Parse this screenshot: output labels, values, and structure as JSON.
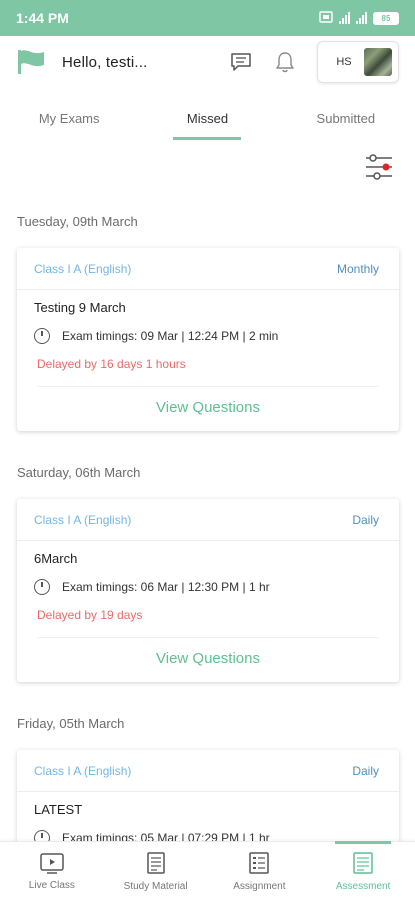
{
  "status_bar": {
    "time": "1:44 PM",
    "battery": "85"
  },
  "header": {
    "greeting": "Hello, testi...",
    "profile_initials": "HS"
  },
  "tabs": [
    {
      "label": "My Exams",
      "active": false
    },
    {
      "label": "Missed",
      "active": true
    },
    {
      "label": "Submitted",
      "active": false
    }
  ],
  "exams": [
    {
      "date": "Tuesday, 09th March",
      "class": "Class I A (English)",
      "frequency": "Monthly",
      "title": "Testing 9 March",
      "timings": "Exam timings:  09 Mar | 12:24 PM | 2 min",
      "delay": "Delayed by 16 days 1 hours",
      "action": "View Questions"
    },
    {
      "date": "Saturday, 06th March",
      "class": "Class I A (English)",
      "frequency": "Daily",
      "title": "6March",
      "timings": "Exam timings:  06 Mar | 12:30 PM | 1 hr",
      "delay": "Delayed by 19 days",
      "action": "View Questions"
    },
    {
      "date": "Friday, 05th March",
      "class": "Class I A (English)",
      "frequency": "Daily",
      "title": "LATEST",
      "timings": "Exam timings:  05 Mar | 07:29 PM | 1 hr",
      "delay": "",
      "action": ""
    }
  ],
  "bottom_nav": [
    {
      "label": "Live Class",
      "icon": "video-icon",
      "active": false
    },
    {
      "label": "Study Material",
      "icon": "document-icon",
      "active": false
    },
    {
      "label": "Assignment",
      "icon": "list-icon",
      "active": false
    },
    {
      "label": "Assessment",
      "icon": "assessment-icon",
      "active": true
    }
  ],
  "colors": {
    "accent": "#7fc6a4",
    "link": "#5fbf94",
    "delay": "#ea6a6a",
    "class_label": "#74b6e3"
  }
}
